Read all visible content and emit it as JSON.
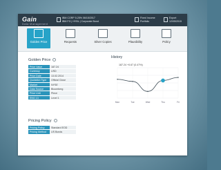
{
  "app": {
    "logo_text": "Gain",
    "logo_sub": "Data Management"
  },
  "header": {
    "instrument_line1": "IBM CORP 5.25% 06/15/2017",
    "instrument_line2_a": "IBM FG",
    "instrument_line2_b": "HYBL",
    "instrument_line2_c": "Corporate Bond",
    "asset_line1": "Fixed Income",
    "asset_line2": "Portfolio",
    "export_line1": "Export",
    "export_line2": "12/05/2015"
  },
  "toolbar": {
    "items": [
      {
        "label": "Golden Price",
        "icon": "golden-price-icon"
      },
      {
        "label": "Requests",
        "icon": "requests-icon"
      },
      {
        "label": "Silver Copies",
        "icon": "silver-copies-icon"
      },
      {
        "label": "Plausibility",
        "icon": "plausibility-icon"
      },
      {
        "label": "Policy",
        "icon": "policy-icon"
      }
    ]
  },
  "golden_price": {
    "title": "Golden Price",
    "rows": [
      {
        "key": "Price Value",
        "value": "187.24"
      },
      {
        "key": "Currency",
        "value": "USD"
      },
      {
        "key": "Price Date",
        "value": "13.02.2014"
      },
      {
        "key": "Quotation Type",
        "value": "Official Close"
      },
      {
        "key": "Market",
        "value": "NYSE"
      },
      {
        "key": "Data Source",
        "value": "Bloomberg"
      },
      {
        "key": "Price Unit",
        "value": "Piece"
      },
      {
        "key": "ENG 13",
        "value": "Level 1"
      }
    ]
  },
  "pricing_policy": {
    "title": "Pricing Policy",
    "rows": [
      {
        "key": "Pricing Policy",
        "value": "Standard EOD"
      },
      {
        "key": "Pricing Method",
        "value": "US Bonds"
      }
    ]
  },
  "history": {
    "title": "History",
    "value_text": "187.24 +0.67 (0.47%)",
    "chart_data": {
      "type": "line",
      "categories": [
        "Mon",
        "Tue",
        "Wed",
        "Thu",
        "Fri"
      ],
      "values": [
        0.62,
        0.55,
        0.22,
        0.58,
        0.68
      ],
      "ylim": [
        0,
        1
      ],
      "grid": true,
      "accent": "#27a3c8"
    }
  },
  "colors": {
    "accent": "#27a3c8",
    "header": "#2c3c48"
  }
}
